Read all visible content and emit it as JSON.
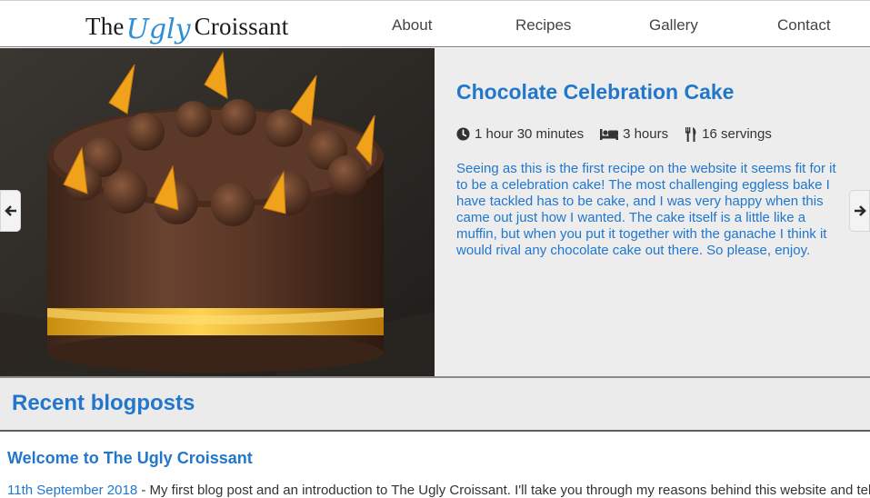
{
  "logo": {
    "the": "The",
    "ugly": "Ugly",
    "croissant": "Croissant"
  },
  "nav": {
    "about": "About",
    "recipes": "Recipes",
    "gallery": "Gallery",
    "contact": "Contact"
  },
  "hero": {
    "title": "Chocolate Celebration Cake",
    "prep_time": "1 hour 30 minutes",
    "rest_time": "3 hours",
    "servings": "16 servings",
    "description": "Seeing as this is the first recipe on the website it seems fit for it to be a celebration cake! The most challenging eggless bake I have tackled has to be cake, and I was very happy when this came out just how I wanted. The cake itself is a little like a muffin, but when you put it together with the ganache I think it would rival any chocolate cake out there. So please, enjoy.",
    "prev_icon": "arrow-left-icon",
    "next_icon": "arrow-right-icon"
  },
  "recent": {
    "heading": "Recent blogposts"
  },
  "post": {
    "title": "Welcome to The Ugly Croissant",
    "date": "11th September 2018",
    "excerpt": "My first blog post and an introduction to The Ugly Croissant. I'll take you through my reasons behind this website and tell"
  },
  "colors": {
    "accent": "#2277cc",
    "logo_blue": "#2e8fd6",
    "hero_bg": "#ededed"
  }
}
